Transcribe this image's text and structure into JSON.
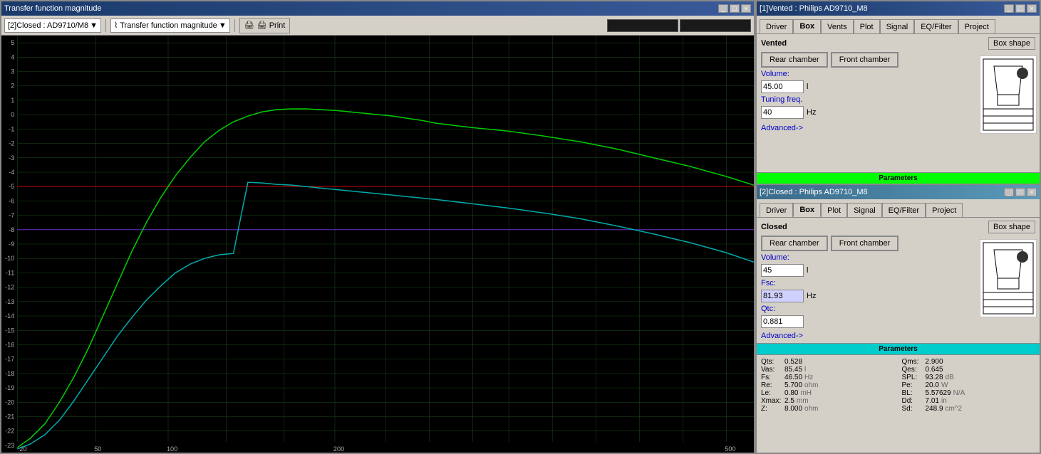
{
  "left_window": {
    "title": "Transfer function magnitude",
    "controls": [
      "_",
      "□",
      "×"
    ],
    "toolbar": {
      "dropdown1": "[2]Closed : AD9710/M8",
      "dropdown1_icon": "▼",
      "dropdown2": "⌇ Transfer function magnitude",
      "dropdown2_icon": "▼",
      "print_btn": "🖨 Print"
    },
    "y_labels": [
      "5",
      "4",
      "3",
      "2",
      "1",
      "0",
      "-1",
      "-2",
      "-3",
      "-4",
      "-5",
      "-6",
      "-7",
      "-8",
      "-9",
      "-10",
      "-11",
      "-12",
      "-13",
      "-14",
      "-15",
      "-16",
      "-17",
      "-18",
      "-19",
      "-20",
      "-21",
      "-22",
      "-23"
    ],
    "x_labels": [
      "20",
      "50",
      "100",
      "200",
      "500"
    ]
  },
  "vented_window": {
    "title": "[1]Vented : Philips AD9710_M8",
    "controls": [
      "_",
      "□",
      "×"
    ],
    "tabs": [
      "Driver",
      "Box",
      "Vents",
      "Plot",
      "Signal",
      "EQ/Filter",
      "Project"
    ],
    "active_tab": "Box",
    "section_label": "Vented",
    "box_shape_btn": "Box shape",
    "rear_chamber_btn": "Rear chamber",
    "front_chamber_btn": "Front chamber",
    "volume_label": "Volume:",
    "volume_value": "45.00",
    "volume_unit": "l",
    "tuning_label": "Tuning freq.",
    "tuning_value": "40",
    "tuning_unit": "Hz",
    "advanced_link": "Advanced->",
    "parameters_bar": "Parameters"
  },
  "closed_window": {
    "title": "[2]Closed : Philips AD9710_M8",
    "controls": [
      "_",
      "□",
      "×"
    ],
    "tabs": [
      "Driver",
      "Box",
      "Plot",
      "Signal",
      "EQ/Filter",
      "Project"
    ],
    "active_tab": "Box",
    "section_label": "Closed",
    "box_shape_btn": "Box shape",
    "rear_chamber_btn": "Rear chamber",
    "front_chamber_btn": "Front chamber",
    "volume_label": "Volume:",
    "volume_value": "45",
    "volume_unit": "l",
    "fsc_label": "Fsc:",
    "fsc_value": "81.93",
    "fsc_unit": "Hz",
    "qtc_label": "Qtc:",
    "qtc_value": "0.881",
    "advanced_link": "Advanced->",
    "parameters_bar": "Parameters"
  },
  "parameters": {
    "cols": [
      [
        {
          "label": "Qts:",
          "value": "0.528",
          "unit": ""
        },
        {
          "label": "Vas:",
          "value": "85.45",
          "unit": "l"
        },
        {
          "label": "Fs:",
          "value": "46.50",
          "unit": "Hz"
        },
        {
          "label": "Re:",
          "value": "5.700",
          "unit": "ohm"
        },
        {
          "label": "Le:",
          "value": "0.80",
          "unit": "mH"
        },
        {
          "label": "Xmax:",
          "value": "2.5",
          "unit": "mm"
        },
        {
          "label": "Z:",
          "value": "8.000",
          "unit": "ohm"
        }
      ],
      [
        {
          "label": "Qms:",
          "value": "2.900",
          "unit": ""
        },
        {
          "label": "Qes:",
          "value": "0.645",
          "unit": ""
        },
        {
          "label": "SPL:",
          "value": "93.28",
          "unit": "dB"
        },
        {
          "label": "Pe:",
          "value": "20.0",
          "unit": "W"
        },
        {
          "label": "BL:",
          "value": "5.57629",
          "unit": "N/A"
        },
        {
          "label": "Dd:",
          "value": "7.01",
          "unit": "in"
        },
        {
          "label": "Sd:",
          "value": "248.9",
          "unit": "cm^2"
        }
      ]
    ]
  }
}
